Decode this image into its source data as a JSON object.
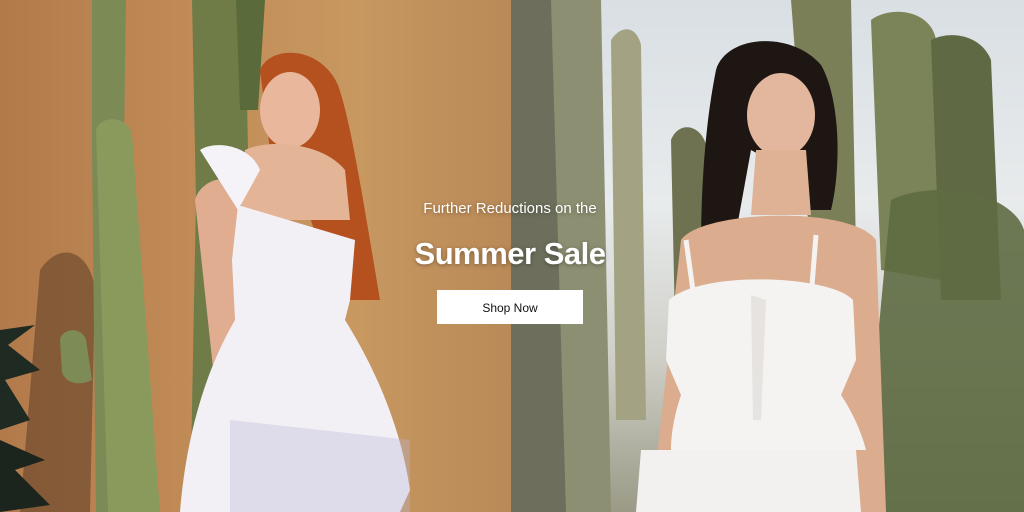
{
  "banner": {
    "eyebrow": "Further Reductions on the",
    "headline": "Summer Sale",
    "cta_label": "Shop Now"
  },
  "colors": {
    "text": "#ffffff",
    "button_bg": "#ffffff",
    "button_text": "#111111",
    "left_wall": "#c08a56",
    "right_sky": "#e8ebec",
    "cactus": "#7f8a55"
  },
  "imagery": {
    "left_photo": "model-white-smocked-mini-dress-cactus-wall",
    "right_photo": "model-white-eyelet-tie-front-top-cactus-garden"
  }
}
